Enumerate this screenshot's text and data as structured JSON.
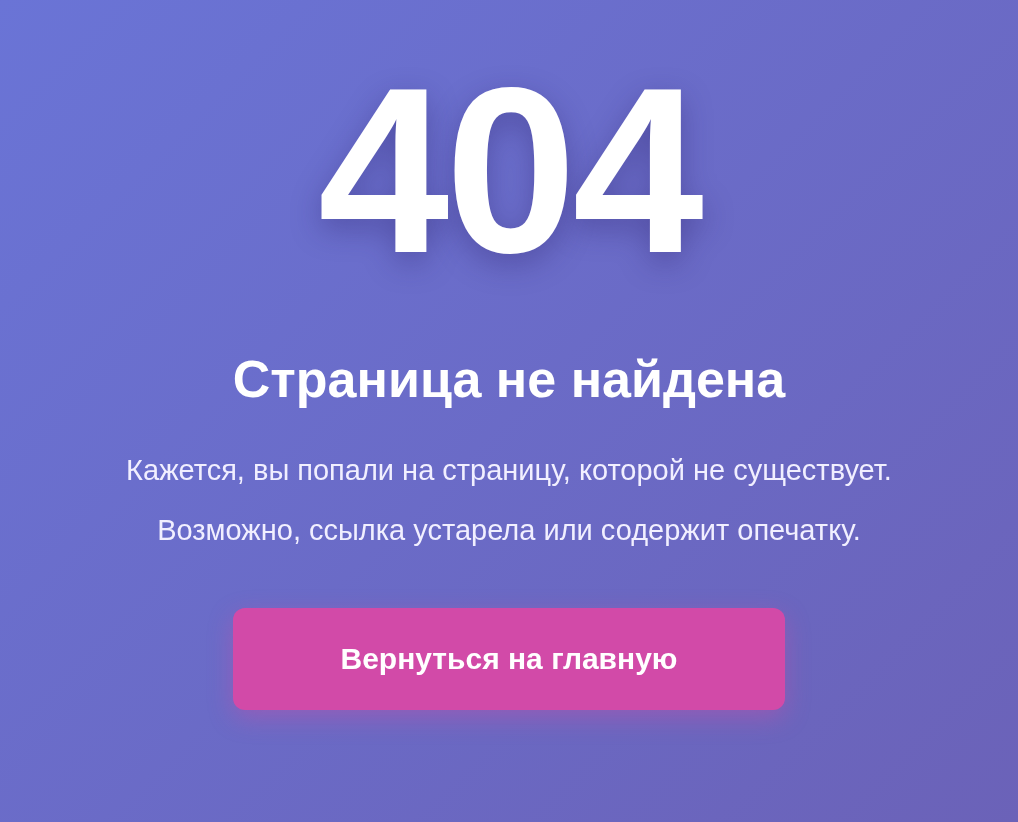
{
  "error_code": "404",
  "title": "Страница не найдена",
  "message_lines": [
    "Кажется, вы попали на страницу, которой не существует.",
    "Возможно, ссылка устарела или содержит опечатку."
  ],
  "button": {
    "label": "Вернуться на главную"
  }
}
